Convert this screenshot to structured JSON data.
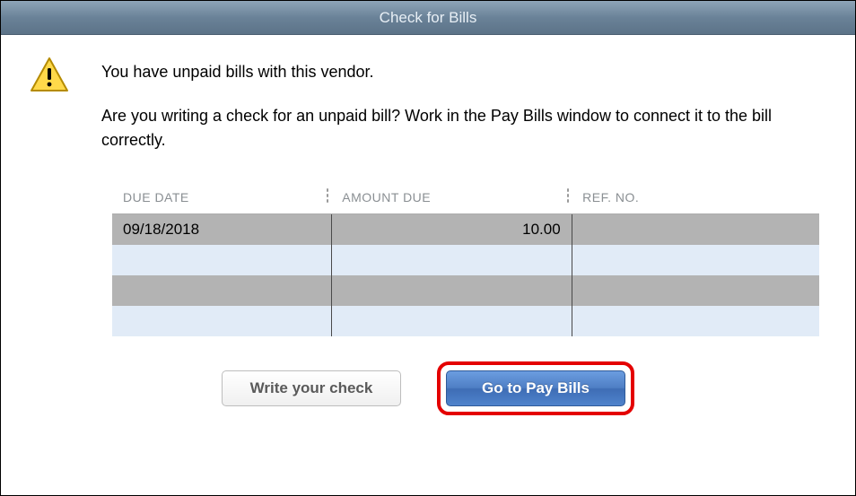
{
  "titlebar": {
    "title": "Check for Bills"
  },
  "message": {
    "line1": "You have unpaid bills with this vendor.",
    "line2": "Are you writing a check for an unpaid bill? Work in the Pay Bills window to connect it to the bill correctly."
  },
  "table": {
    "headers": {
      "due_date": "DUE DATE",
      "amount_due": "AMOUNT DUE",
      "ref_no": "REF. NO."
    },
    "rows": [
      {
        "due_date": "09/18/2018",
        "amount_due": "10.00",
        "ref_no": ""
      }
    ]
  },
  "buttons": {
    "write_check": "Write your check",
    "go_to_pay_bills": "Go to Pay Bills"
  }
}
